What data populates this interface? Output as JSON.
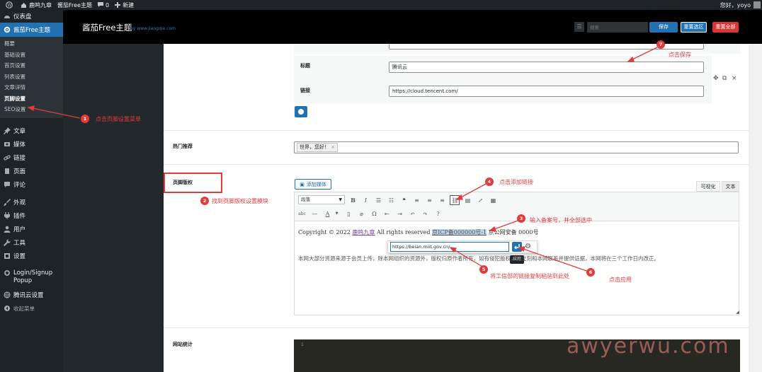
{
  "admin_bar": {
    "site_name": "鹿鸣九章",
    "theme_link": "酱茄Free主题",
    "comments_count": "0",
    "new_label": "新建",
    "greeting": "您好，yoyo"
  },
  "sidebar": {
    "dashboard": "仪表盘",
    "theme": "酱茄Free主题",
    "submenu": [
      "概要",
      "基础设置",
      "首页设置",
      "列表设置",
      "文章详情",
      "页脚设置",
      "SEO设置"
    ],
    "items": [
      {
        "label": "文章",
        "icon": "pin-icon"
      },
      {
        "label": "媒体",
        "icon": "media-icon"
      },
      {
        "label": "链接",
        "icon": "link-icon"
      },
      {
        "label": "页面",
        "icon": "page-icon"
      },
      {
        "label": "评论",
        "icon": "comment-icon"
      },
      {
        "label": "外观",
        "icon": "brush-icon"
      },
      {
        "label": "插件",
        "icon": "plugin-icon"
      },
      {
        "label": "用户",
        "icon": "user-icon"
      },
      {
        "label": "工具",
        "icon": "wrench-icon"
      },
      {
        "label": "设置",
        "icon": "settings-icon"
      }
    ],
    "login_popup": "Login/Signup Popup",
    "tencent": "腾讯云设置",
    "collapse": "收起菜单"
  },
  "topbar": {
    "title": "酱茄Free主题",
    "subtitle": "by www.jiangqie.com",
    "search_placeholder": "搜索",
    "save": "保存",
    "reset_section": "重置选区",
    "reset_all": "重置全部"
  },
  "links_group": {
    "title_label": "标题",
    "title_value": "腾讯云",
    "link_label": "链接",
    "link_value": "https://cloud.tencent.com/"
  },
  "hot": {
    "label": "热门推荐",
    "tag": "世界，您好！",
    "tag_remove": "×"
  },
  "footer_copyright": {
    "label": "页脚版权",
    "add_media": "添加媒体",
    "tab_visual": "可视化",
    "tab_text": "文本",
    "format": "段落",
    "copyright_prefix": "Copyright © 2022 ",
    "site_link": "鹿鸣九章",
    "reserved": " All rights reserved ",
    "icp": "京ICP备000000号-1",
    "police": " 京公网安备 0000号",
    "link_url": "https://beian.miit.gov.cn/",
    "apply_tooltip": "应用",
    "body_text": "本网大部分资源来源于会员上传，除本网组织的资源外，版权归原作者所有，如有侵犯版权，请立刻和本网联系并提供证据，本网将在三个工作日内改正。"
  },
  "stats": {
    "label": "网站统计",
    "line": "1"
  },
  "annotations": [
    {
      "num": "1",
      "text": "点击页脚设置菜单"
    },
    {
      "num": "2",
      "text": "找到页脚版权设置模块"
    },
    {
      "num": "3",
      "text": "输入备案号，并全部选中"
    },
    {
      "num": "4",
      "text": "点击添加链接"
    },
    {
      "num": "5",
      "text": "将工信部的链接复制粘贴到此处"
    },
    {
      "num": "6",
      "text": "点击应用"
    },
    {
      "num": "7",
      "text": "点击保存"
    }
  ],
  "watermark": "awyerwu.com",
  "colors": {
    "accent": "#2271b1",
    "danger": "#d63638",
    "annotation": "#e23b3b"
  }
}
